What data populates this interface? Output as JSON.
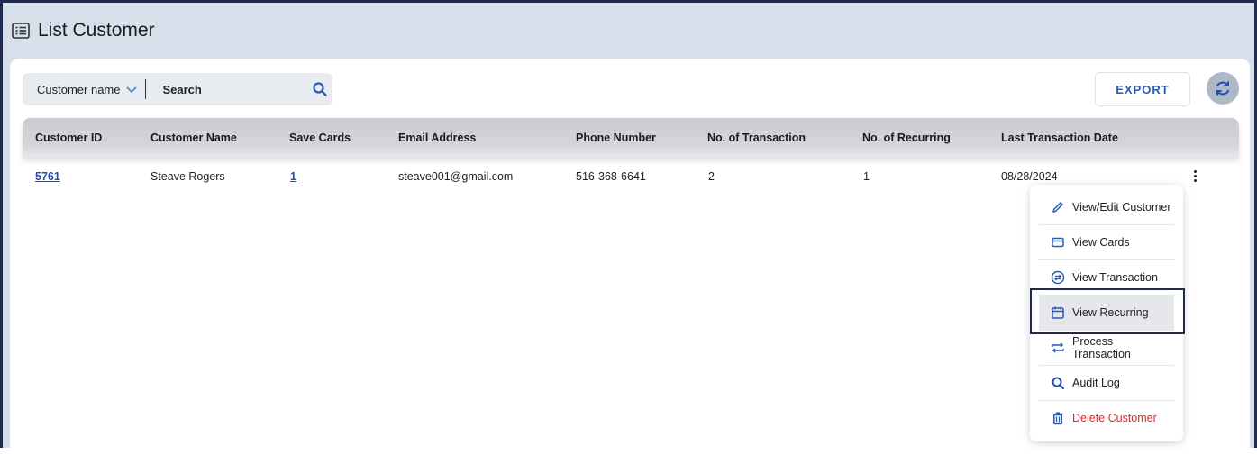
{
  "page": {
    "title": "List Customer"
  },
  "toolbar": {
    "filter_label": "Customer name",
    "search_placeholder": "Search",
    "export_label": "EXPORT"
  },
  "table": {
    "headers": [
      "Customer ID",
      "Customer Name",
      "Save Cards",
      "Email Address",
      "Phone Number",
      "No. of Transaction",
      "No. of Recurring",
      "Last Transaction Date"
    ],
    "rows": [
      [
        "5761",
        "Steave Rogers",
        "1",
        "steave001@gmail.com",
        "516-368-6641",
        "2",
        "1",
        "08/28/2024"
      ]
    ]
  },
  "menu": {
    "items": [
      {
        "label": "View/Edit Customer",
        "icon": "pencil-icon"
      },
      {
        "label": "View Cards",
        "icon": "card-icon"
      },
      {
        "label": "View Transaction",
        "icon": "exchange-icon"
      },
      {
        "label": "View Recurring",
        "icon": "calendar-icon"
      },
      {
        "label": "Process Transaction",
        "icon": "repeat-icon"
      },
      {
        "label": "Audit Log",
        "icon": "search-icon"
      },
      {
        "label": "Delete Customer",
        "icon": "trash-icon"
      }
    ],
    "active_index": 3
  },
  "colors": {
    "accent": "#2a5ab8",
    "danger": "#e3242b",
    "frame": "#1f2c4d",
    "header_bg": "#d7dfeb"
  }
}
